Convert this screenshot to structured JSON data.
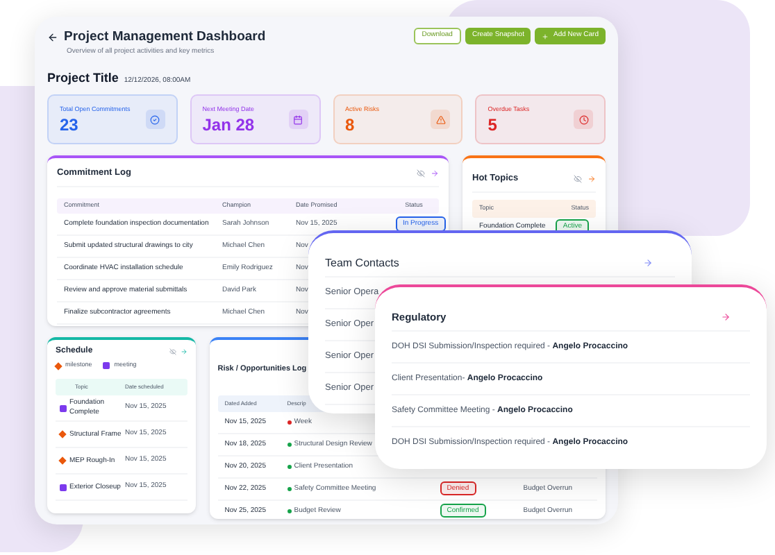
{
  "header": {
    "title": "Project Management Dashboard",
    "subtitle": "Overview of all project activities and key metrics",
    "buttons": [
      {
        "label": "Download",
        "kind": "outline"
      },
      {
        "label": "Create Snapshot",
        "kind": "solid"
      },
      {
        "label": "Add New Card",
        "kind": "add"
      }
    ]
  },
  "project": {
    "title": "Project Title",
    "date": "12/12/2026, 08:00AM"
  },
  "stats": [
    {
      "label": "Total Open Commitments",
      "value": "23",
      "color": "#2563eb"
    },
    {
      "label": "Next Meeting Date",
      "value": "Jan 28",
      "color": "#9333ea"
    },
    {
      "label": "Active Risks",
      "value": "8",
      "color": "#ea580c"
    },
    {
      "label": "Overdue Tasks",
      "value": "5",
      "color": "#dc2626"
    }
  ],
  "commitment_log": {
    "title": "Commitment Log",
    "columns": [
      "Commitment",
      "Champion",
      "Date Promised",
      "Status"
    ],
    "rows": [
      {
        "commitment": "Complete foundation inspection documentation",
        "champion": "Sarah Johnson",
        "date": "Nov 15, 2025",
        "status": {
          "label": "In Progress",
          "color": "#2563eb"
        }
      },
      {
        "commitment": "Submit updated structural drawings to city",
        "champion": "Michael Chen",
        "date": "Nov"
      },
      {
        "commitment": "Coordinate HVAC installation schedule",
        "champion": "Emily Rodriguez",
        "date": "Nov"
      },
      {
        "commitment": "Review and approve material submittals",
        "champion": "David Park",
        "date": "Nov"
      },
      {
        "commitment": "Finalize subcontractor agreements",
        "champion": "Michael Chen",
        "date": "Nov"
      }
    ]
  },
  "hot_topics": {
    "title": "Hot Topics",
    "columns": [
      "Topic",
      "Status"
    ],
    "rows": [
      {
        "topic": "Foundation Complete",
        "status": {
          "label": "Active",
          "color": "#16a34a"
        }
      }
    ]
  },
  "schedule": {
    "title": "Schedule",
    "legend": [
      {
        "label": "milestone",
        "kind": "milestone"
      },
      {
        "label": "meeting",
        "kind": "meeting"
      }
    ],
    "columns": [
      "Topic",
      "Date scheduled"
    ],
    "rows": [
      {
        "topic": "Foundation Complete",
        "date": "Nov 15, 2025",
        "kind": "meeting"
      },
      {
        "topic": "Structural Frame",
        "date": "Nov 15, 2025",
        "kind": "milestone"
      },
      {
        "topic": "MEP Rough-In",
        "date": "Nov 15, 2025",
        "kind": "milestone"
      },
      {
        "topic": "Exterior Closeup",
        "date": "Nov 15, 2025",
        "kind": "meeting"
      }
    ]
  },
  "risk_log": {
    "title": "Risk / Opportunities Log",
    "columns": [
      "Dated Added",
      "Descrip"
    ],
    "rows": [
      {
        "date": "Nov 15, 2025",
        "description": "Week",
        "color": "#dc2626"
      },
      {
        "date": "Nov 18, 2025",
        "description": "Structural Design Review",
        "color": "#16a34a"
      },
      {
        "date": "Nov 20, 2025",
        "description": "Client Presentation",
        "color": "#16a34a"
      },
      {
        "date": "Nov 22, 2025",
        "description": "Safety Committee Meeting",
        "color": "#16a34a",
        "status": {
          "label": "Denied",
          "color": "#dc2626"
        },
        "impact": "Budget Overrun"
      },
      {
        "date": "Nov 25, 2025",
        "description": "Budget Review",
        "color": "#16a34a",
        "status": {
          "label": "Confirmed",
          "color": "#16a34a"
        },
        "impact": "Budget Overrun"
      }
    ]
  },
  "team_contacts": {
    "title": "Team Contacts",
    "rows": [
      "Senior Opera",
      "Senior Oper",
      "Senior Oper",
      "Senior Oper"
    ]
  },
  "regulatory": {
    "title": "Regulatory",
    "rows": [
      "DOH DSI Submission/Inspection required - **Angelo Procaccino**",
      "Client Presentation- **Angelo Procaccino**",
      "Safety Committee Meeting - **Angelo Procaccino**",
      "DOH DSI Submission/Inspection required - **Angelo Procaccino**"
    ]
  }
}
